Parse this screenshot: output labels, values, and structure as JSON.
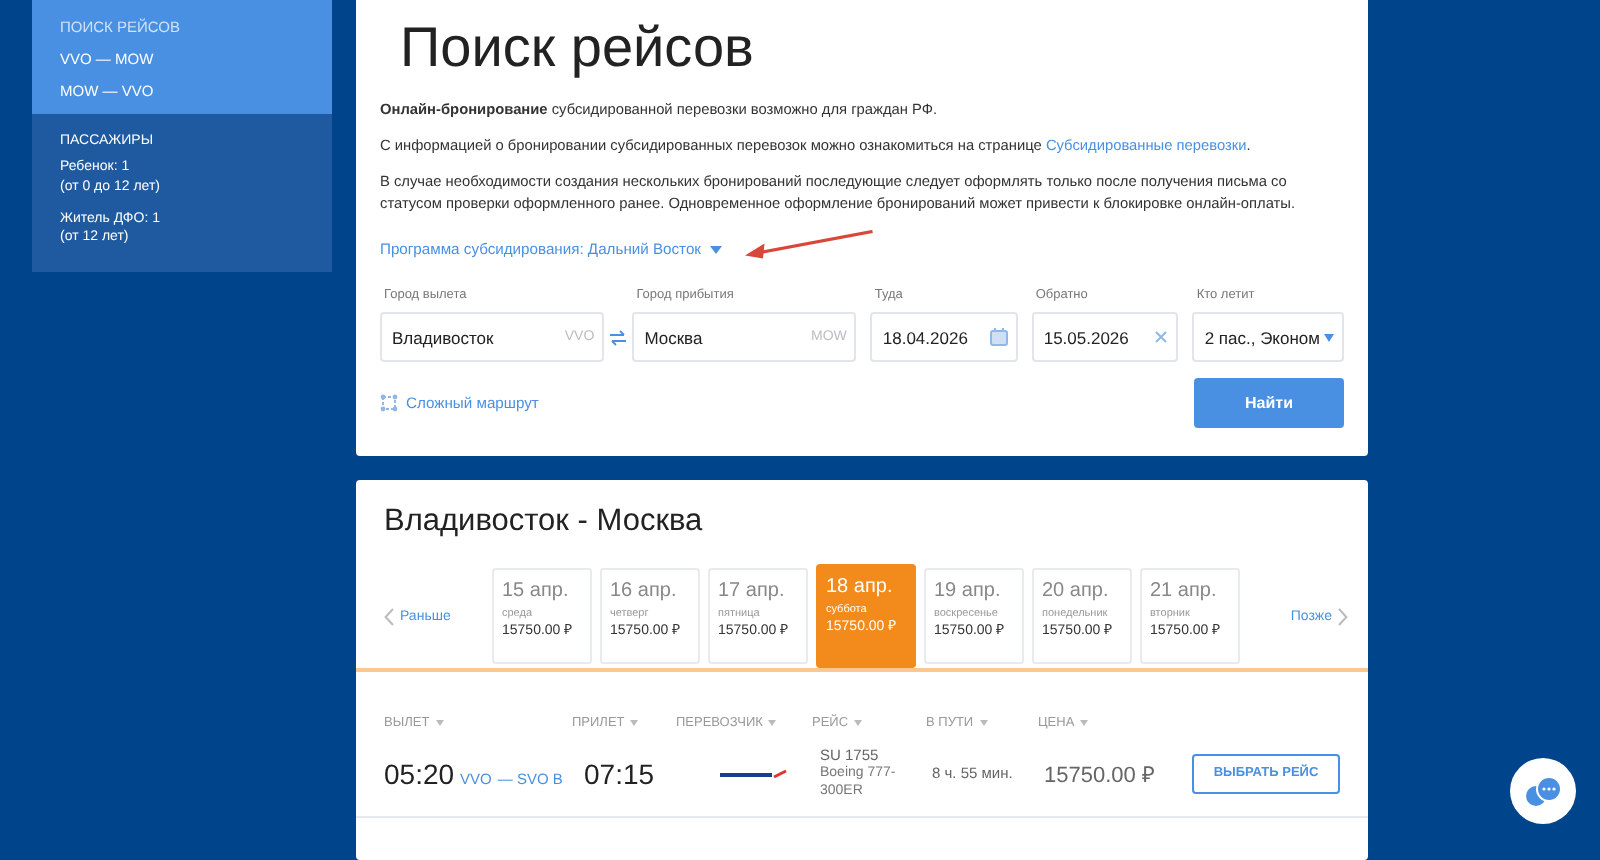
{
  "sidebar": {
    "nav": [
      {
        "label": "ПОИСК РЕЙСОВ",
        "selected": true
      },
      {
        "label": "VVO — MOW",
        "selected": false
      },
      {
        "label": "MOW — VVO",
        "selected": false
      }
    ],
    "passengers": {
      "title": "ПАССАЖИРЫ",
      "groups": [
        {
          "name": "Ребенок: 1",
          "note": "(от 0 до 12 лет)"
        },
        {
          "name": "Житель ДФО: 1",
          "note": "(от 12 лет)"
        }
      ]
    }
  },
  "search": {
    "title": "Поиск рейсов",
    "info": [
      "**Онлайн-бронирование** субсидированной перевозки возможно для граждан РФ.",
      "В случае необходимости создания нескольких бронирований последующие следует оформлять только после получения письма со статусом проверки оформленного ранее. Одновременное оформление бронирований может привести к блокировке онлайн-оплаты."
    ],
    "info_link": {
      "text": "С информацией о бронировании субсидированных перевозок можно ознакомиться на странице",
      "link": "Субсидированные перевозки",
      "end": "."
    },
    "program": "Программа субсидирования: Дальний Восток",
    "fields": [
      {
        "kind": "city",
        "label": "Город вылета",
        "value": "Владивосток",
        "code": "VVO"
      },
      {
        "kind": "city",
        "label": "Город прибытия",
        "value": "Москва",
        "code": "MOW"
      },
      {
        "kind": "date",
        "label": "Туда",
        "value": "18.04.2026"
      },
      {
        "kind": "clear",
        "label": "Обратно",
        "value": "15.05.2026"
      },
      {
        "kind": "select",
        "label": "Кто летит",
        "value": "2 пас., Эконом"
      }
    ],
    "complex_route": "Сложный маршрут",
    "submit": "Найти"
  },
  "results": {
    "title": "Владивосток - Москва",
    "earlier": "Раньше",
    "later": "Позже",
    "dates": [
      {
        "date": "15 апр.",
        "weekday": "среда",
        "price": "15750.00 ₽",
        "selected": false
      },
      {
        "date": "16 апр.",
        "weekday": "четверг",
        "price": "15750.00 ₽",
        "selected": false
      },
      {
        "date": "17 апр.",
        "weekday": "пятница",
        "price": "15750.00 ₽",
        "selected": false
      },
      {
        "date": "18 апр.",
        "weekday": "суббота",
        "price": "15750.00 ₽",
        "selected": true
      },
      {
        "date": "19 апр.",
        "weekday": "воскресенье",
        "price": "15750.00 ₽",
        "selected": false
      },
      {
        "date": "20 апр.",
        "weekday": "понедельник",
        "price": "15750.00 ₽",
        "selected": false
      },
      {
        "date": "21 апр.",
        "weekday": "вторник",
        "price": "15750.00 ₽",
        "selected": false
      }
    ],
    "columns": [
      "ВЫЛЕТ",
      "ПРИЛЕТ",
      "ПЕРЕВОЗЧИК",
      "РЕЙС",
      "В ПУТИ",
      "ЦЕНА"
    ],
    "flight": {
      "dep_time": "05:20",
      "dep_code": "VVO",
      "route": "— SVO B",
      "arr_time": "07:15",
      "flight_no": "SU 1755",
      "aircraft": "Boeing 777-300ER",
      "duration": "8 ч. 55 мин.",
      "price": "15750.00 ₽",
      "action": "ВЫБРАТЬ РЕЙС"
    }
  }
}
